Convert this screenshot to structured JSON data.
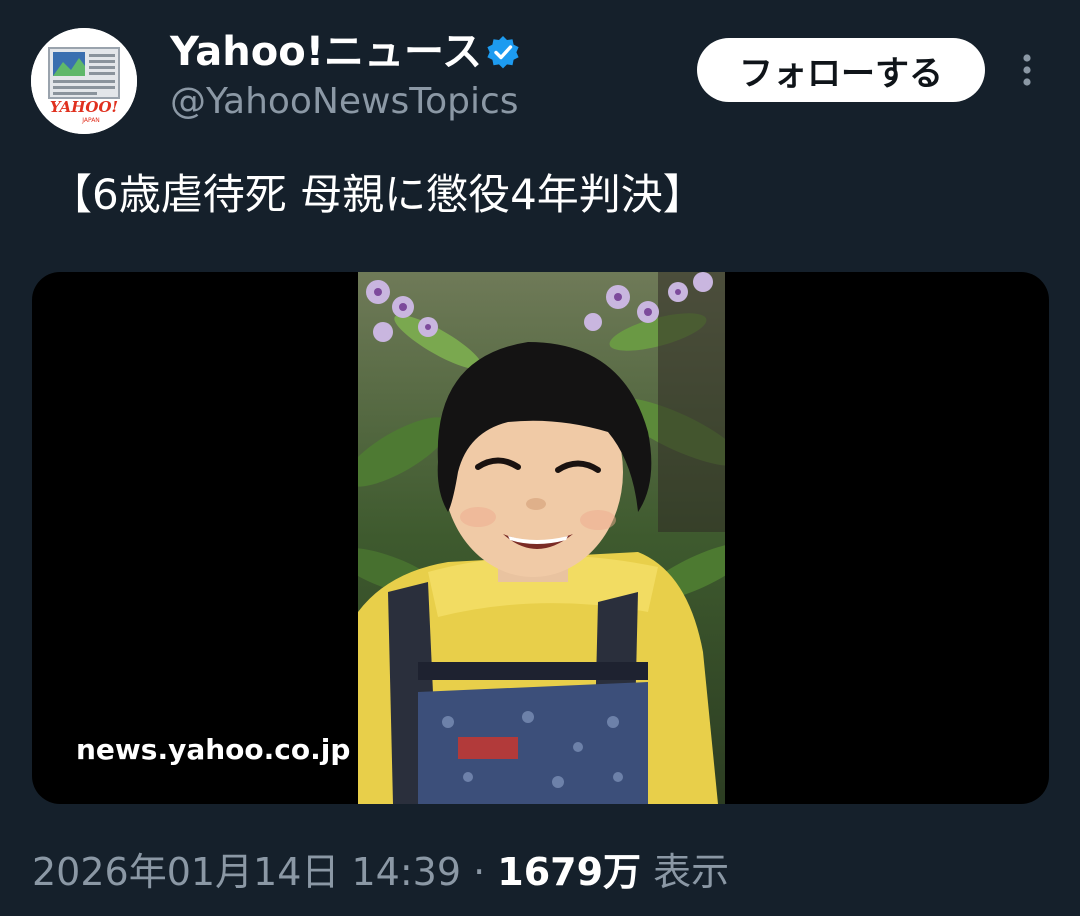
{
  "author": {
    "display_name": "Yahoo!ニュース",
    "handle": "@YahooNewsTopics",
    "avatar_logo_text": "YAHOO!",
    "avatar_logo_subtext": "JAPAN",
    "verified_icon": "verified-badge-icon"
  },
  "actions": {
    "follow_label": "フォローする",
    "more_icon": "more-options-icon"
  },
  "tweet": {
    "text": "【6歳虐待死 母親に懲役4年判決】"
  },
  "media": {
    "domain": "news.yahoo.co.jp",
    "image_description_icon": "child-photo"
  },
  "meta": {
    "timestamp": "2026年01月14日 14:39",
    "separator": " · ",
    "views_count": "1679万",
    "views_label": " 表示"
  },
  "colors": {
    "background": "#15202b",
    "verified": "#1d9bf0",
    "secondary_text": "#8b98a5",
    "follow_button_bg": "#ffffff"
  }
}
